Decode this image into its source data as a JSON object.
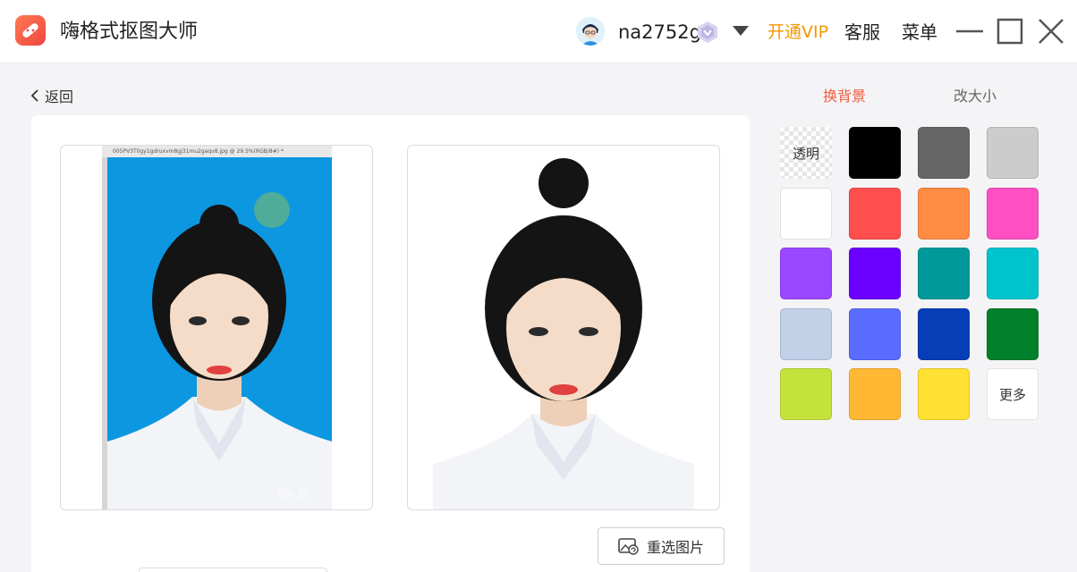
{
  "app": {
    "title": "嗨格式抠图大师"
  },
  "header": {
    "username": "na2752g",
    "vip_label": "开通VIP",
    "service_label": "客服",
    "menu_label": "菜单",
    "colors": {
      "vip": "#f39800"
    }
  },
  "nav": {
    "back_label": "返回"
  },
  "editor": {
    "original_filename": "005PV3T0gy1gdruxvm8gj31mu2gaqv8.jpg @ 29.5%(RGB/8#) *",
    "watermark": "Bai 百",
    "reselect_label": "重选图片"
  },
  "panel": {
    "tabs": [
      {
        "label": "换背景",
        "active": true
      },
      {
        "label": "改大小",
        "active": false
      }
    ],
    "accent_color": "#f05a3c",
    "swatches": [
      {
        "label": "透明",
        "color": "transparent"
      },
      {
        "label": "",
        "color": "#000000"
      },
      {
        "label": "",
        "color": "#666666"
      },
      {
        "label": "",
        "color": "#cccccc"
      },
      {
        "label": "",
        "color": "#ffffff"
      },
      {
        "label": "",
        "color": "#ff4e4e"
      },
      {
        "label": "",
        "color": "#ff8c42"
      },
      {
        "label": "",
        "color": "#ff4fc3"
      },
      {
        "label": "",
        "color": "#9b46ff"
      },
      {
        "label": "",
        "color": "#6a00ff"
      },
      {
        "label": "",
        "color": "#00999b"
      },
      {
        "label": "",
        "color": "#00c4cc"
      },
      {
        "label": "",
        "color": "#c0d1e8"
      },
      {
        "label": "",
        "color": "#5a6cff"
      },
      {
        "label": "",
        "color": "#063eb8"
      },
      {
        "label": "",
        "color": "#00802a"
      },
      {
        "label": "",
        "color": "#c4e23c"
      },
      {
        "label": "",
        "color": "#ffb833"
      },
      {
        "label": "",
        "color": "#ffe033"
      },
      {
        "label": "更多",
        "color": "more"
      }
    ]
  }
}
